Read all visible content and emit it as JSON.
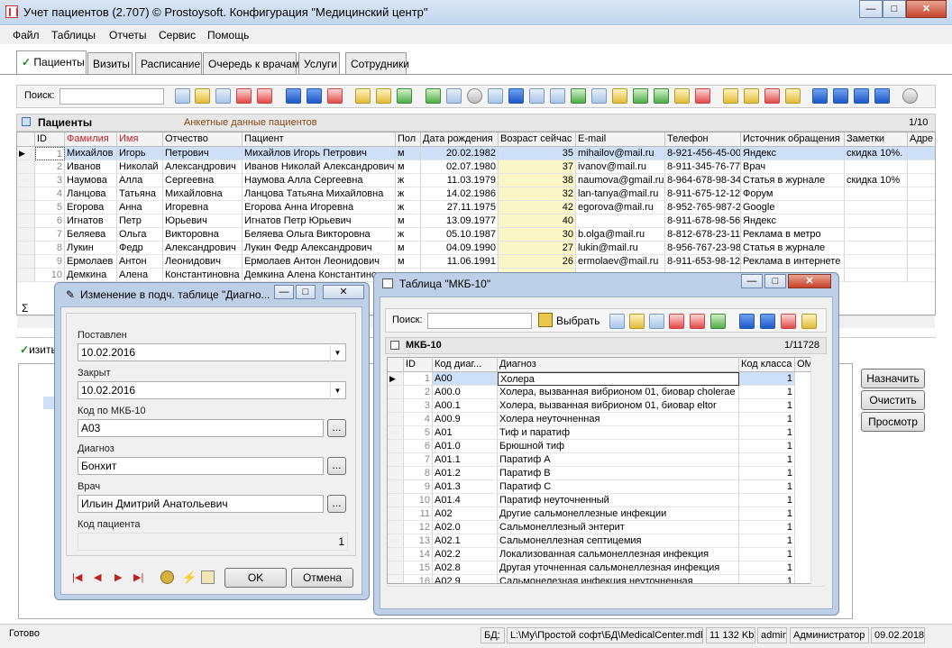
{
  "window": {
    "title": "Учет пациентов (2.707) © Prostoysoft. Конфигурация \"Медицинский центр\"",
    "min_label": "—",
    "max_label": "□",
    "close_label": "✕"
  },
  "menu": [
    "Файл",
    "Таблицы",
    "Отчеты",
    "Сервис",
    "Помощь"
  ],
  "tabs": [
    "Пациенты",
    "Визиты",
    "Расписание",
    "Очередь к врачам",
    "Услуги",
    "Сотрудники"
  ],
  "toolbar": {
    "search_label": "Поиск:",
    "search_value": ""
  },
  "patients": {
    "header": "Пациенты",
    "subtitle": "Анкетные данные пациентов",
    "counter": "1/10",
    "columns": [
      "ID",
      "Фамилия",
      "Имя",
      "Отчество",
      "Пациент",
      "Пол",
      "Дата рождения",
      "Возраст сейчас",
      "E-mail",
      "Телефон",
      "Источник обращения",
      "Заметки",
      "Адре"
    ],
    "rows": [
      [
        "1",
        "Михайлов",
        "Игорь",
        "Петрович",
        "Михайлов Игорь Петрович",
        "м",
        "20.02.1982",
        "35",
        "mihailov@mail.ru",
        "8-921-456-45-00",
        "Яндекс",
        "скидка 10%.",
        ""
      ],
      [
        "2",
        "Иванов",
        "Николай",
        "Александрович",
        "Иванов Николай Александрович",
        "м",
        "02.07.1980",
        "37",
        "ivanov@mail.ru",
        "8-911-345-76-77",
        "Врач",
        "",
        ""
      ],
      [
        "3",
        "Наумова",
        "Алла",
        "Сергеевна",
        "Наумова Алла Сергеевна",
        "ж",
        "11.03.1979",
        "38",
        "naumova@gmail.ru",
        "8-964-678-98-34",
        "Статья в журнале",
        "скидка 10%",
        ""
      ],
      [
        "4",
        "Ланцова",
        "Татьяна",
        "Михайловна",
        "Ланцова Татьяна Михайловна",
        "ж",
        "14.02.1986",
        "32",
        "lan-tanya@mail.ru",
        "8-911-675-12-12",
        "Форум",
        "",
        ""
      ],
      [
        "5",
        "Егорова",
        "Анна",
        "Игоревна",
        "Егорова Анна Игоревна",
        "ж",
        "27.11.1975",
        "42",
        "egorova@mail.ru",
        "8-952-765-987-23",
        "Google",
        "",
        ""
      ],
      [
        "6",
        "Игнатов",
        "Петр",
        "Юрьевич",
        "Игнатов  Петр Юрьевич",
        "м",
        "13.09.1977",
        "40",
        "",
        "8-911-678-98-56",
        "Яндекс",
        "",
        ""
      ],
      [
        "7",
        "Беляева",
        "Ольга",
        "Викторовна",
        "Беляева  Ольга Викторовна",
        "ж",
        "05.10.1987",
        "30",
        "b.olga@mail.ru",
        "8-812-678-23-11",
        "Реклама в метро",
        "",
        ""
      ],
      [
        "8",
        "Лукин",
        "Федр",
        "Александрович",
        "Лукин Федр Александрович",
        "м",
        "04.09.1990",
        "27",
        "lukin@mail.ru",
        "8-956-767-23-98",
        "Статья в журнале",
        "",
        ""
      ],
      [
        "9",
        "Ермолаев",
        "Антон",
        "Леонидович",
        "Ермолаев Антон Леонидович",
        "м",
        "11.06.1991",
        "26",
        "ermolaev@mail.ru",
        "8-911-653-98-12",
        "Реклама в интернете",
        "",
        ""
      ],
      [
        "10",
        "Демкина",
        "Алена",
        "Константиновна",
        "Демкина Алена Константиновна",
        "",
        "",
        "",
        "",
        "",
        "",
        "",
        ""
      ]
    ]
  },
  "lower": {
    "tab_label": "изиты",
    "buttons": [
      "Назначить",
      "Очистить",
      "Просмотр"
    ]
  },
  "edit_dialog": {
    "title": "Изменение в подч. таблице \"Диагно...",
    "fields": [
      {
        "label": "Поставлен",
        "value": "10.02.2016",
        "kind": "date"
      },
      {
        "label": "Закрыт",
        "value": "10.02.2016",
        "kind": "date"
      },
      {
        "label": "Код по МКБ-10",
        "value": "A03",
        "kind": "lookup"
      },
      {
        "label": "Диагноз",
        "value": "Бонхит",
        "kind": "lookup"
      },
      {
        "label": "Врач",
        "value": "Ильин Дмитрий Анатольевич",
        "kind": "lookup"
      },
      {
        "label": "Код пациента",
        "value": "1",
        "kind": "readonly"
      }
    ],
    "ok_label": "OK",
    "cancel_label": "Отмена",
    "ellipsis": "..."
  },
  "mkb_dialog": {
    "title": "Таблица \"МКБ-10\"",
    "search_label": "Поиск:",
    "select_label": "Выбрать",
    "section": "МКБ-10",
    "counter": "1/11728",
    "columns": [
      "ID",
      "Код диаг...",
      "Диагноз",
      "Код класса",
      "ОМ"
    ],
    "rows": [
      [
        "1",
        "A00",
        "Холера",
        "1"
      ],
      [
        "2",
        "A00.0",
        "Холера, вызванная вибрионом 01, биовар cholerae",
        "1"
      ],
      [
        "3",
        "A00.1",
        "Холера, вызванная вибрионом 01, биовар eltor",
        "1"
      ],
      [
        "4",
        "A00.9",
        "Холера неуточненная",
        "1"
      ],
      [
        "5",
        "A01",
        "Тиф и паратиф",
        "1"
      ],
      [
        "6",
        "A01.0",
        "Брюшной тиф",
        "1"
      ],
      [
        "7",
        "A01.1",
        "Паратиф А",
        "1"
      ],
      [
        "8",
        "A01.2",
        "Паратиф В",
        "1"
      ],
      [
        "9",
        "A01.3",
        "Паратиф С",
        "1"
      ],
      [
        "10",
        "A01.4",
        "Паратиф неуточненный",
        "1"
      ],
      [
        "11",
        "A02",
        "Другие сальмонеллезные инфекции",
        "1"
      ],
      [
        "12",
        "A02.0",
        "Сальмонеллезный энтерит",
        "1"
      ],
      [
        "13",
        "A02.1",
        "Сальмонеллезная септицемия",
        "1"
      ],
      [
        "14",
        "A02.2",
        "Локализованная сальмонеллезная инфекция",
        "1"
      ],
      [
        "15",
        "A02.8",
        "Другая уточненная сальмонеллезная инфекция",
        "1"
      ],
      [
        "16",
        "A02.9",
        "Сальмонелезная инфекция неуточненная",
        "1"
      ]
    ]
  },
  "status": {
    "ready": "Готово",
    "db_label": "БД:",
    "db_path": "L:\\Му\\Простой софт\\БД\\MedicalCenter.mdb",
    "size": "11 132 Kb",
    "user": "admin",
    "role": "Администратор",
    "date": "09.02.2018"
  }
}
